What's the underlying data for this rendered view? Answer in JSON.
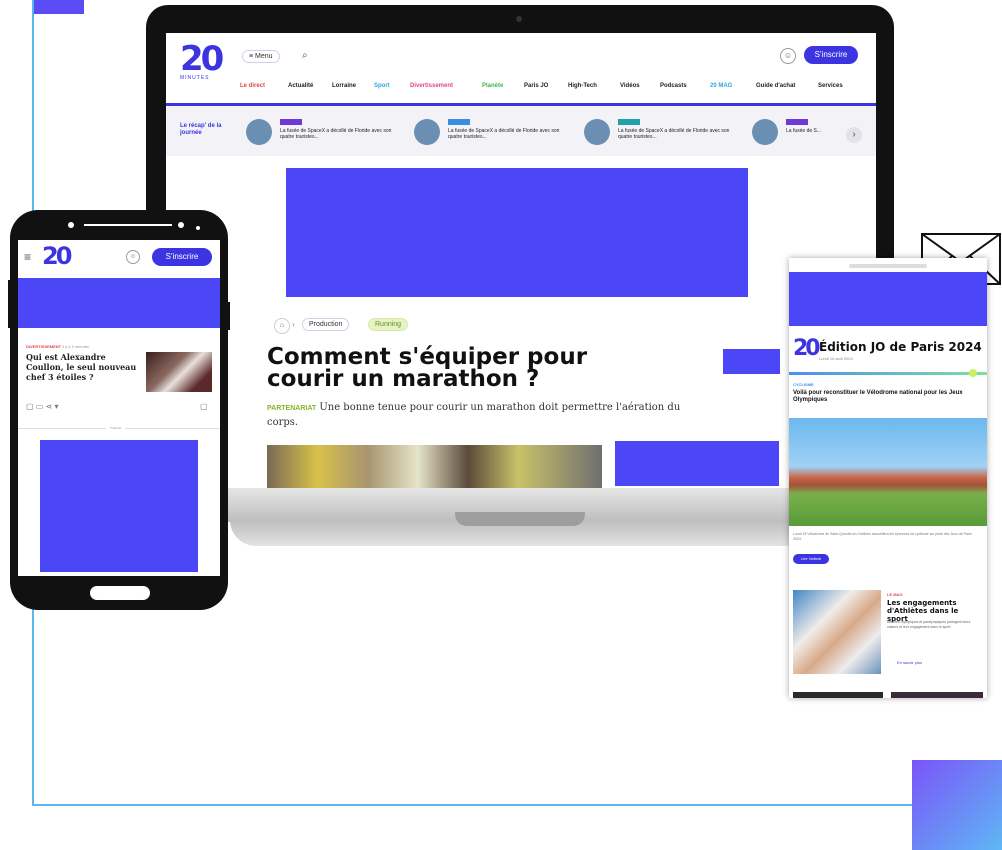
{
  "colors": {
    "accent": "#4b47f7",
    "brand": "#3b34e0",
    "frame": "#5ab6ee"
  },
  "laptop": {
    "logo": "20",
    "logo_sub": "MINUTES",
    "menu_label": "Menu",
    "subscribe_label": "S'inscrire",
    "nav": [
      "Le direct",
      "Actualité",
      "Lorraine",
      "Sport",
      "Divertissement",
      "Planète",
      "Paris JO",
      "High-Tech",
      "Vidéos",
      "Podcasts",
      "20 MAG",
      "Guide d'achat",
      "Services"
    ],
    "recap_title": "Le récap' de la journée",
    "stories": [
      {
        "text": "La fusée de SpaceX a décollé de Floride avec son quatre touristes..."
      },
      {
        "text": "La fusée de SpaceX a décollé de Floride avec son quatre touristes..."
      },
      {
        "text": "La fusée de SpaceX a décollé de Floride avec son quatre touristes..."
      },
      {
        "text": "La fusée de S..."
      }
    ],
    "breadcrumb_home_icon": "home-icon",
    "breadcrumb_section": "Production",
    "breadcrumb_tag": "Running",
    "headline": "Comment s'équiper pour courir un marathon ?",
    "chapo_label": "PARTENARIAT",
    "chapo_text": "Une bonne tenue pour courir un marathon doit permettre l'aération du corps."
  },
  "phone": {
    "logo": "20",
    "subscribe_label": "S'inscrire",
    "kicker": "DIVERTISSEMENT",
    "kicker_time": "il y a 9 minutes",
    "article_title": "Qui est Alexandre Coullon, le seul nouveau chef 3 étoiles ?",
    "divider_label": "Publicité"
  },
  "tablet": {
    "logo": "20",
    "edition_title": "Édition JO de Paris 2024",
    "edition_sub": "Lundi 15 avril 2024",
    "section": "CYCLISME",
    "headline": "Voilà pour reconstituer le Vélodrome national pour les Jeux Olympiques",
    "caption": "Lundi 15 Vélodrome de Saint-Quentin-en-Yvelines accueillera les épreuves de cyclisme sur piste des Jeux de Paris 2024.",
    "read_label": "Lire l'article",
    "card_kicker": "LE MAG",
    "card_title": "Les engagements d'Athlètes dans le sport",
    "card_text": "Athlètes olympiques et paralympiques partagent leurs valeurs et leur engagement dans le sport.",
    "card_link": "En savoir plus"
  }
}
